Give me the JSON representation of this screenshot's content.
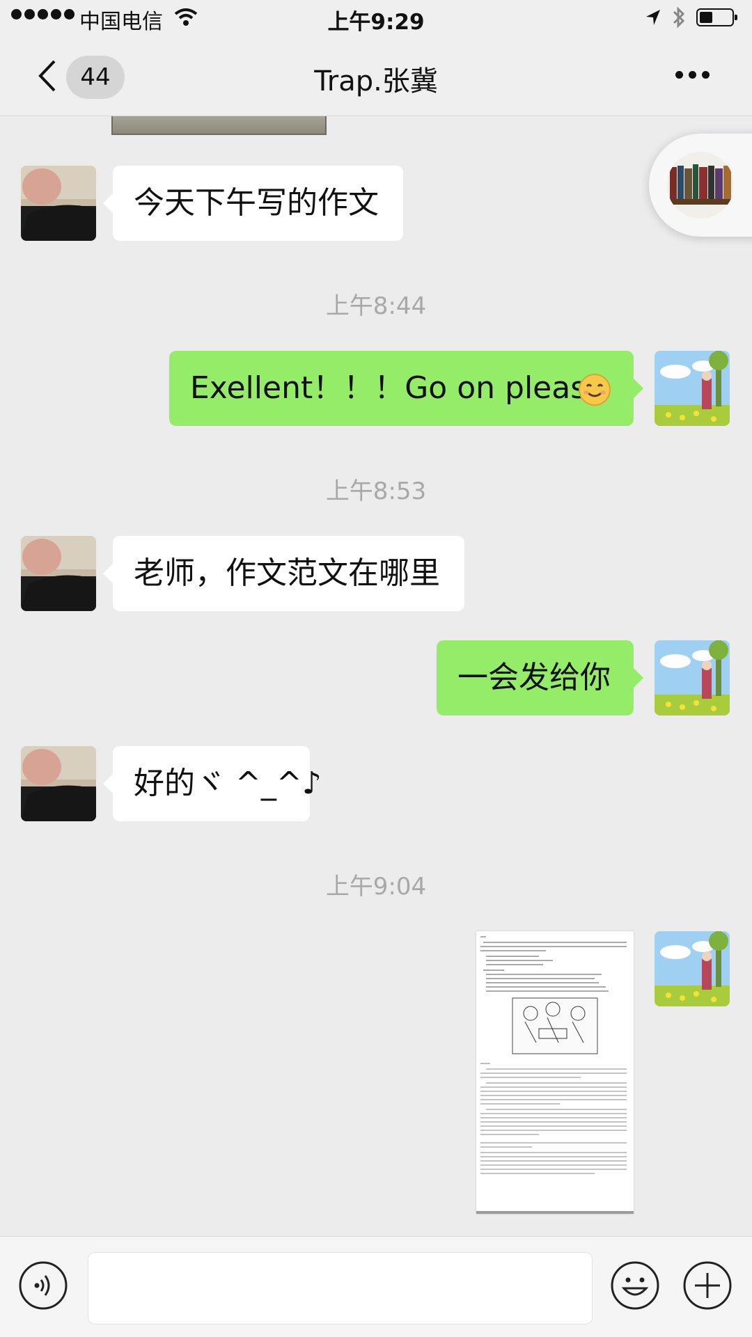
{
  "status_bar": {
    "carrier": "中国电信",
    "time": "上午9:29"
  },
  "nav": {
    "back_count": "44",
    "title": "Trap.张冀"
  },
  "messages": [
    {
      "sender": "contact",
      "type": "text",
      "text": "今天下午写的作文"
    },
    {
      "type": "timestamp",
      "text": "上午8:44"
    },
    {
      "sender": "me",
      "type": "text",
      "text": "Exellent！！！Go on please",
      "emoji": "smiling-face"
    },
    {
      "type": "timestamp",
      "text": "上午8:53"
    },
    {
      "sender": "contact",
      "type": "text",
      "text": "老师，作文范文在哪里"
    },
    {
      "sender": "me",
      "type": "text",
      "text": "一会发给你"
    },
    {
      "sender": "contact",
      "type": "text",
      "text": "好的ヾ ^_^♪"
    },
    {
      "type": "timestamp",
      "text": "上午9:04"
    },
    {
      "sender": "me",
      "type": "image",
      "description": "essay-document"
    }
  ],
  "icons": {
    "voice": "voice-icon",
    "emoji": "emoji-icon",
    "plus": "plus-icon",
    "back": "chevron-left-icon",
    "more": "more-icon"
  },
  "colors": {
    "outgoing_bubble": "#95ec69",
    "incoming_bubble": "#ffffff",
    "background": "#ececed"
  }
}
